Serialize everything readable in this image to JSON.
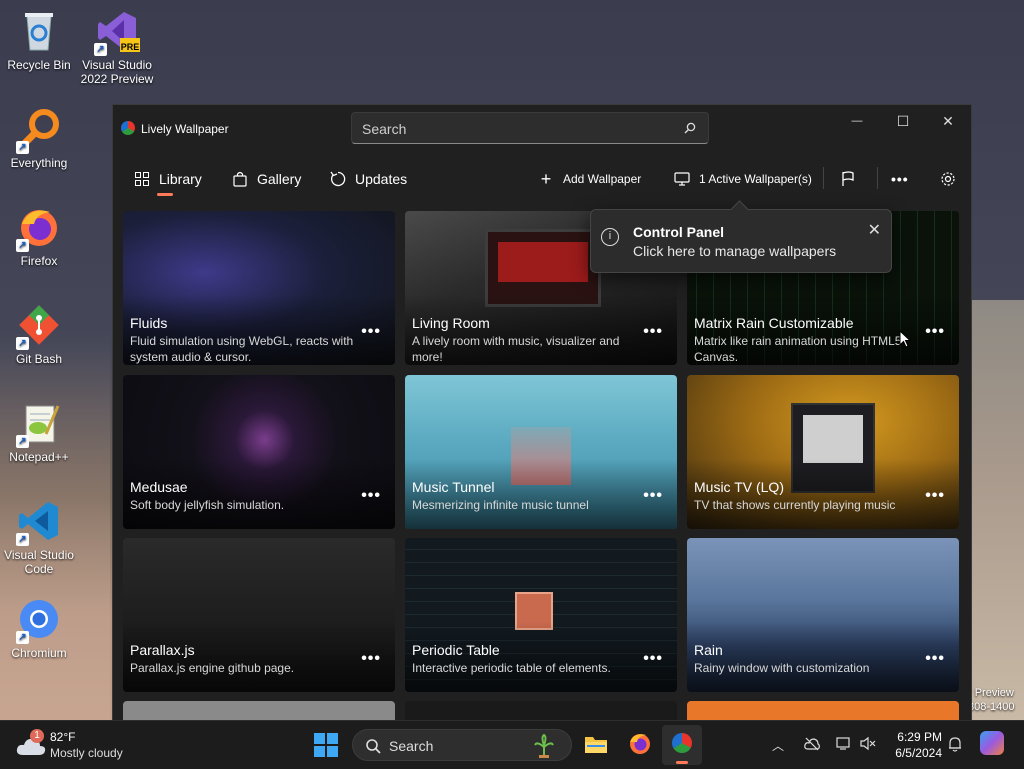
{
  "desktop": {
    "icons": [
      {
        "label": "Recycle Bin"
      },
      {
        "label": "Visual Studio 2022 Preview",
        "line1": "Visual Studio",
        "line2": "2022 Preview",
        "badge": "PRE"
      },
      {
        "label": "Everything"
      },
      {
        "label": "Firefox"
      },
      {
        "label": "Git Bash"
      },
      {
        "label": "Notepad++"
      },
      {
        "label": "Visual Studio Code",
        "line1": "Visual Studio",
        "line2": "Code"
      },
      {
        "label": "Chromium"
      }
    ],
    "preview_text_line1": "r Preview",
    "preview_text_line2": "308-1400"
  },
  "window": {
    "title": "Lively Wallpaper",
    "search_placeholder": "Search",
    "controls": {
      "minimize": "—",
      "maximize": "☐",
      "close": "✕"
    }
  },
  "nav": {
    "library": "Library",
    "gallery": "Gallery",
    "updates": "Updates",
    "add_wallpaper": "Add Wallpaper",
    "active_wallpapers": "1 Active Wallpaper(s)"
  },
  "toast": {
    "title": "Control Panel",
    "subtitle": "Click here to manage wallpapers"
  },
  "wallpapers": [
    {
      "title": "Fluids",
      "desc": "Fluid simulation using WebGL, reacts with system audio & cursor."
    },
    {
      "title": "Living Room",
      "desc": "A lively room with music, visualizer and more!"
    },
    {
      "title": "Matrix Rain Customizable",
      "desc": "Matrix like rain animation using HTML5 Canvas."
    },
    {
      "title": "Medusae",
      "desc": "Soft body jellyfish simulation."
    },
    {
      "title": "Music Tunnel",
      "desc": "Mesmerizing infinite music tunnel"
    },
    {
      "title": "Music TV (LQ)",
      "desc": "TV that shows currently playing music"
    },
    {
      "title": "Parallax.js",
      "desc": "Parallax.js engine github page."
    },
    {
      "title": "Periodic Table",
      "desc": "Interactive periodic table of elements."
    },
    {
      "title": "Rain",
      "desc": "Rainy window with customization"
    }
  ],
  "more_label": "•••",
  "taskbar": {
    "weather_temp": "82°F",
    "weather_desc": "Mostly cloudy",
    "weather_badge": "1",
    "search_label": "Search",
    "time": "6:29 PM",
    "date": "6/5/2024"
  },
  "colors": {
    "accent": "#ff7a59",
    "window_bg": "#202020",
    "taskbar_bg": "#1c1c1c"
  }
}
